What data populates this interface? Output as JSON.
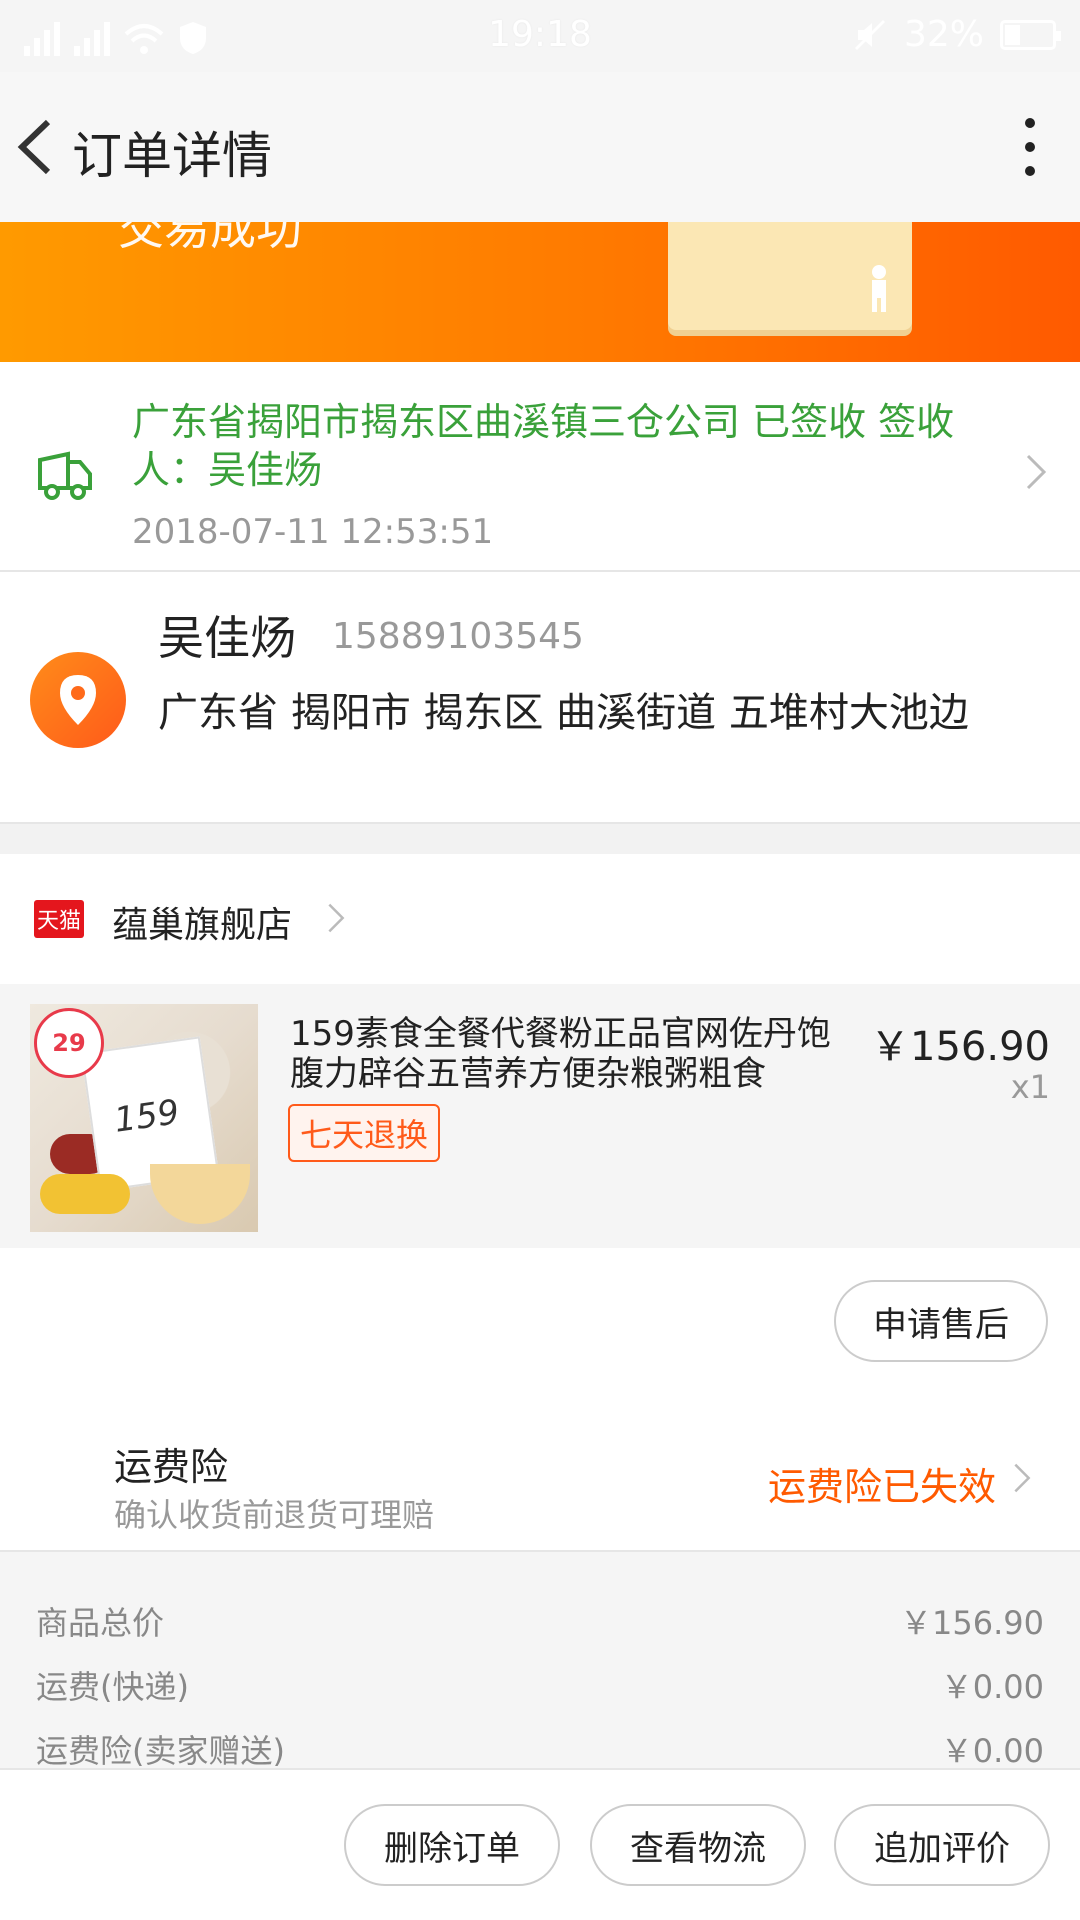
{
  "status_bar": {
    "time": "19:18",
    "battery": "32%"
  },
  "header": {
    "title": "订单详情"
  },
  "banner": {
    "status_text": "交易成功"
  },
  "logistics": {
    "info": "广东省揭阳市揭东区曲溪镇三仓公司 已签收 签收人：吴佳炀",
    "time": "2018-07-11 12:53:51"
  },
  "address": {
    "name": "吴佳炀",
    "phone": "15889103545",
    "address": "广东省 揭阳市 揭东区 曲溪街道 五堆村大池边"
  },
  "shop": {
    "logo_text": "天猫",
    "name": "蕴巢旗舰店"
  },
  "product": {
    "name": "159素食全餐代餐粉正品官网佐丹饱腹力辟谷五营养方便杂粮粥粗食",
    "tag": "七天退换",
    "price": "￥156.90",
    "qty": "x1",
    "image_badge": "29",
    "image_text": "159"
  },
  "after_sale": {
    "button": "申请售后"
  },
  "insurance": {
    "title": "运费险",
    "subtitle": "确认收货前退货可理赔",
    "status": "运费险已失效"
  },
  "costs": [
    {
      "label": "商品总价",
      "value": "￥156.90"
    },
    {
      "label": "运费(快递)",
      "value": "￥0.00"
    },
    {
      "label": "运费险(卖家赠送)",
      "value": "￥0.00"
    }
  ],
  "bottom_actions": {
    "delete": "删除订单",
    "logistics": "查看物流",
    "review": "追加评价"
  },
  "colors": {
    "accent": "#ff5a00",
    "green": "#3aa13a",
    "tmall_red": "#e4161d"
  }
}
